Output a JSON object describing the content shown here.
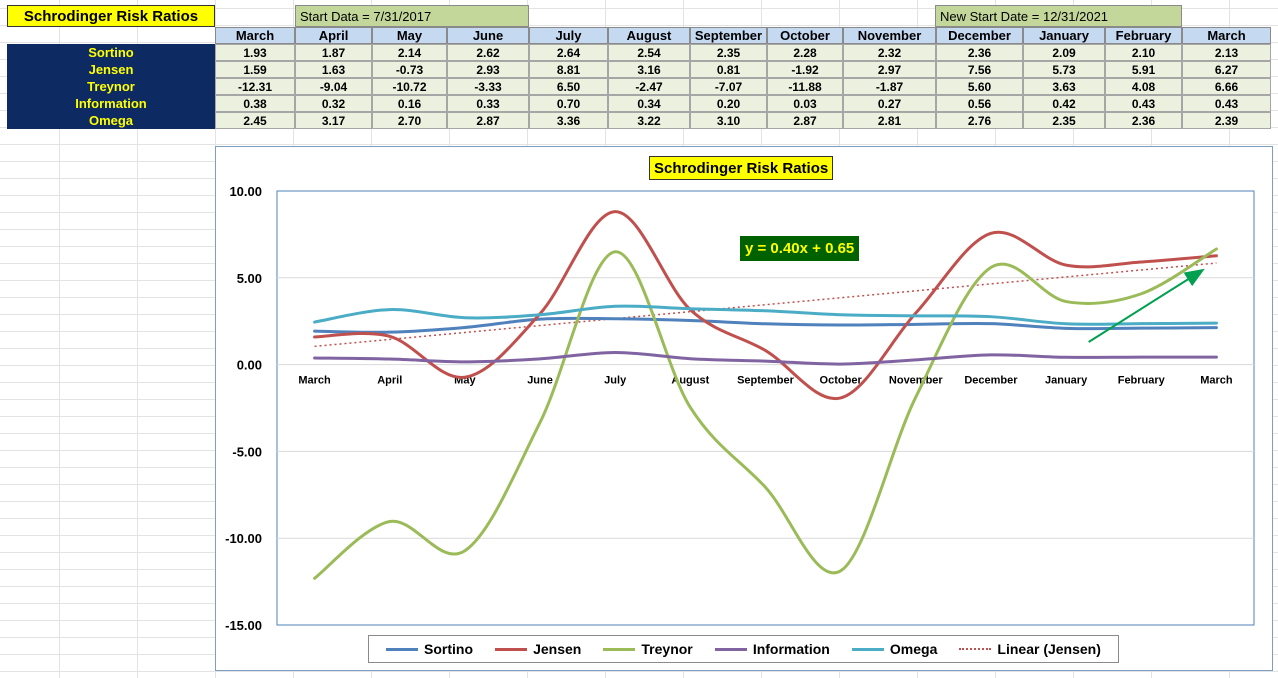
{
  "sheet": {
    "title": "Schrodinger Risk Ratios",
    "start_label": "Start Data = 7/31/2017",
    "new_start_label": "New Start Date = 12/31/2021",
    "months": [
      "March",
      "April",
      "May",
      "June",
      "July",
      "August",
      "September",
      "October",
      "November",
      "December",
      "January",
      "February",
      "March"
    ],
    "rows": [
      {
        "label": "Sortino",
        "values": [
          "1.93",
          "1.87",
          "2.14",
          "2.62",
          "2.64",
          "2.54",
          "2.35",
          "2.28",
          "2.32",
          "2.36",
          "2.09",
          "2.10",
          "2.13"
        ]
      },
      {
        "label": "Jensen",
        "values": [
          "1.59",
          "1.63",
          "-0.73",
          "2.93",
          "8.81",
          "3.16",
          "0.81",
          "-1.92",
          "2.97",
          "7.56",
          "5.73",
          "5.91",
          "6.27"
        ]
      },
      {
        "label": "Treynor",
        "values": [
          "-12.31",
          "-9.04",
          "-10.72",
          "-3.33",
          "6.50",
          "-2.47",
          "-7.07",
          "-11.88",
          "-1.87",
          "5.60",
          "3.63",
          "4.08",
          "6.66"
        ]
      },
      {
        "label": "Information",
        "values": [
          "0.38",
          "0.32",
          "0.16",
          "0.33",
          "0.70",
          "0.34",
          "0.20",
          "0.03",
          "0.27",
          "0.56",
          "0.42",
          "0.43",
          "0.43"
        ]
      },
      {
        "label": "Omega",
        "values": [
          "2.45",
          "3.17",
          "2.70",
          "2.87",
          "3.36",
          "3.22",
          "3.10",
          "2.87",
          "2.81",
          "2.76",
          "2.35",
          "2.36",
          "2.39"
        ]
      }
    ]
  },
  "chart_data": {
    "type": "line",
    "title": "Schrodinger Risk Ratios",
    "categories": [
      "March",
      "April",
      "May",
      "June",
      "July",
      "August",
      "September",
      "October",
      "November",
      "December",
      "January",
      "February",
      "March"
    ],
    "ylim": [
      -15,
      10
    ],
    "yticks": [
      "10.00",
      "5.00",
      "0.00",
      "-5.00",
      "-10.00",
      "-15.00"
    ],
    "grid": "horizontal",
    "legend_position": "bottom",
    "smooth": true,
    "series": [
      {
        "name": "Sortino",
        "color": "#4f81bd",
        "values": [
          1.93,
          1.87,
          2.14,
          2.62,
          2.64,
          2.54,
          2.35,
          2.28,
          2.32,
          2.36,
          2.09,
          2.1,
          2.13
        ]
      },
      {
        "name": "Jensen",
        "color": "#c0504d",
        "values": [
          1.59,
          1.63,
          -0.73,
          2.93,
          8.81,
          3.16,
          0.81,
          -1.92,
          2.97,
          7.56,
          5.73,
          5.91,
          6.27
        ]
      },
      {
        "name": "Treynor",
        "color": "#9bbb59",
        "values": [
          -12.31,
          -9.04,
          -10.72,
          -3.33,
          6.5,
          -2.47,
          -7.07,
          -11.88,
          -1.87,
          5.6,
          3.63,
          4.08,
          6.66
        ]
      },
      {
        "name": "Information",
        "color": "#8064a2",
        "values": [
          0.38,
          0.32,
          0.16,
          0.33,
          0.7,
          0.34,
          0.2,
          0.03,
          0.27,
          0.56,
          0.42,
          0.43,
          0.43
        ]
      },
      {
        "name": "Omega",
        "color": "#4bacc6",
        "values": [
          2.45,
          3.17,
          2.7,
          2.87,
          3.36,
          3.22,
          3.1,
          2.87,
          2.81,
          2.76,
          2.35,
          2.36,
          2.39
        ]
      }
    ],
    "trendline": {
      "name": "Linear (Jensen)",
      "slope": 0.4,
      "intercept": 0.65,
      "color": "#c0504d"
    },
    "equation_label": "y = 0.40x + 0.65",
    "annotation": {
      "type": "arrow",
      "color": "#00a050",
      "from_value": [
        10.3,
        1.3
      ],
      "to_value": [
        11.8,
        5.4
      ]
    }
  }
}
